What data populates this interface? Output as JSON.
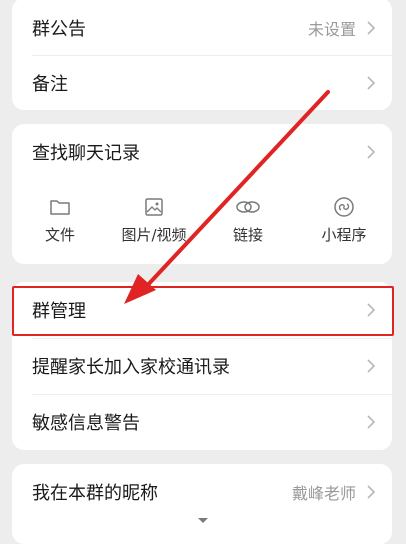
{
  "card1": {
    "announcement": {
      "label": "群公告",
      "value": "未设置"
    },
    "remark": {
      "label": "备注"
    }
  },
  "card2": {
    "search_history": {
      "label": "查找聊天记录"
    },
    "media": [
      {
        "label": "文件",
        "icon": "folder-icon"
      },
      {
        "label": "图片/视频",
        "icon": "image-icon"
      },
      {
        "label": "链接",
        "icon": "link-icon"
      },
      {
        "label": "小程序",
        "icon": "mini-program-icon"
      }
    ]
  },
  "card3": {
    "manage": {
      "label": "群管理"
    },
    "remind_parents": {
      "label": "提醒家长加入家校通讯录"
    },
    "sensitive_warning": {
      "label": "敏感信息警告"
    }
  },
  "card4": {
    "nickname": {
      "label": "我在本群的昵称",
      "value": "戴峰老师"
    }
  },
  "colors": {
    "annotation": "#e02424",
    "background": "#ededed"
  }
}
